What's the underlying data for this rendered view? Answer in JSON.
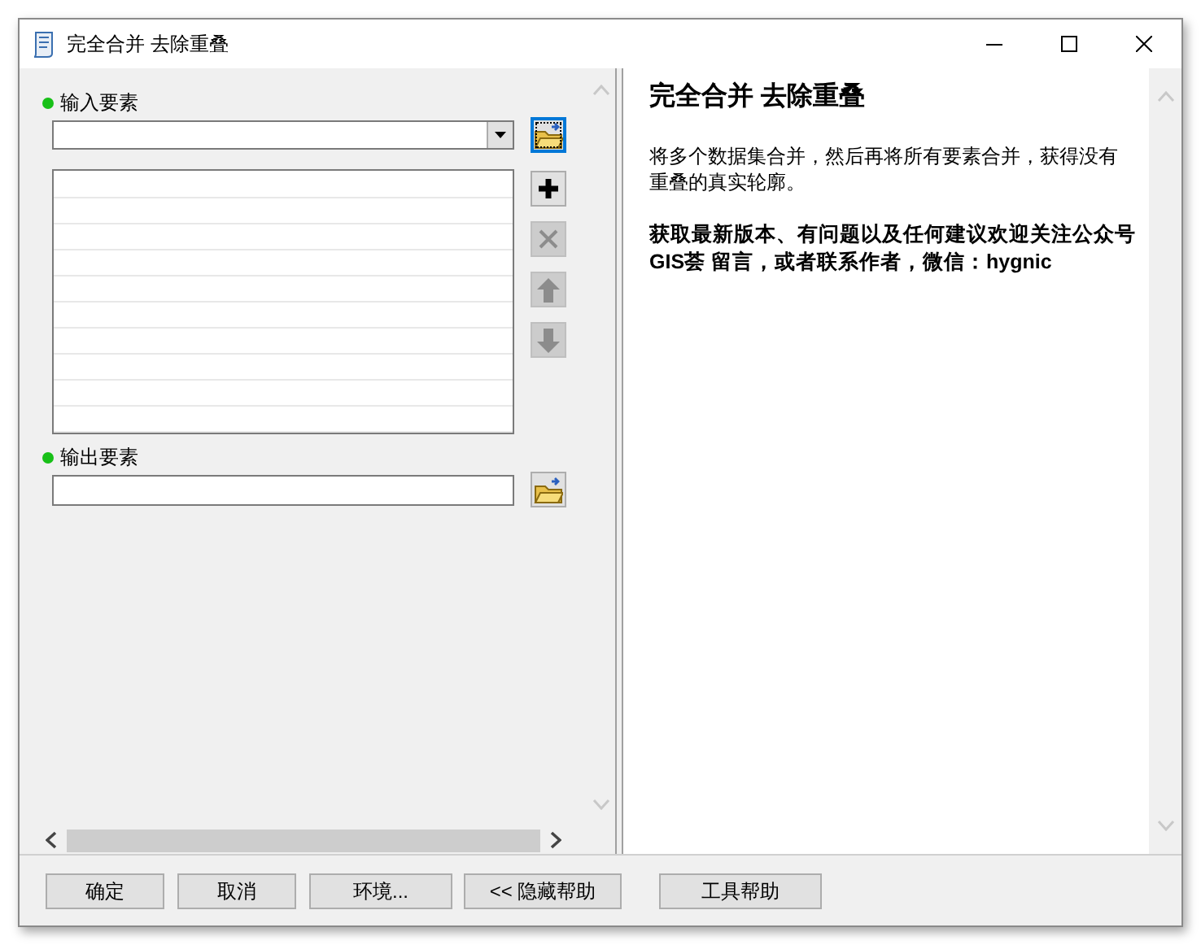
{
  "window": {
    "title": "完全合并 去除重叠"
  },
  "input_features": {
    "label": "输入要素",
    "required": true,
    "browse_focused": true
  },
  "list_tools": [
    {
      "kind": "add",
      "disabled": false
    },
    {
      "kind": "remove",
      "disabled": true
    },
    {
      "kind": "up",
      "disabled": true
    },
    {
      "kind": "down",
      "disabled": true
    }
  ],
  "output_features": {
    "label": "输出要素",
    "required": true,
    "browse_focused": false
  },
  "help": {
    "title": "完全合并 去除重叠",
    "description": "将多个数据集合并，然后再将所有要素合并，获得没有重叠的真实轮廓。",
    "note": "获取最新版本、有问题以及任何建议欢迎关注公众号 GIS荟 留言，或者联系作者，微信：hygnic"
  },
  "buttons": [
    "确定",
    "取消",
    "环境...",
    "<< 隐藏帮助",
    "工具帮助"
  ]
}
